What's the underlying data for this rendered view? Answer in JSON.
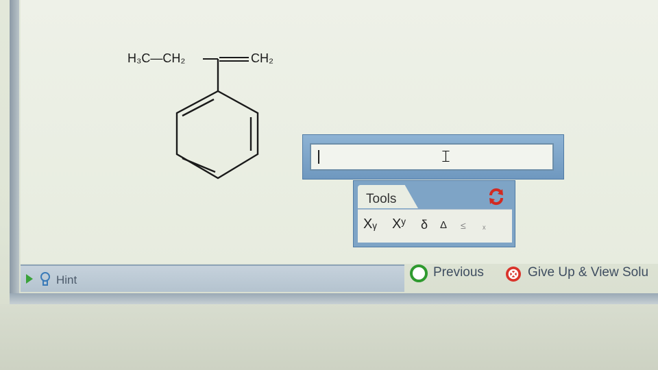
{
  "molecule": {
    "substituent_left": "H₃C—CH₂",
    "substituent_right": "CH₂"
  },
  "answer": {
    "value": ""
  },
  "tools": {
    "tab_label": "Tools",
    "refresh_icon": "refresh-icon",
    "buttons": [
      {
        "label": "Xᵧ",
        "name": "subscript-button"
      },
      {
        "label": "Xʸ",
        "name": "superscript-button"
      },
      {
        "label": "δ",
        "name": "delta-lower-button"
      },
      {
        "label": "Δ",
        "name": "delta-upper-button"
      },
      {
        "label": "≤",
        "name": "less-equal-button"
      },
      {
        "label": "ₓ",
        "name": "misc-button"
      }
    ]
  },
  "hint": {
    "label": "Hint",
    "icon": "lightbulb-icon"
  },
  "nav": {
    "previous_label": "Previous",
    "giveup_label": "Give Up & View Solu",
    "previous_icon": "previous-circle-icon",
    "giveup_icon": "give-up-icon"
  },
  "colors": {
    "accent_blue": "#7ea4c6",
    "refresh_red": "#d22a22",
    "hint_green": "#3aa23a"
  }
}
